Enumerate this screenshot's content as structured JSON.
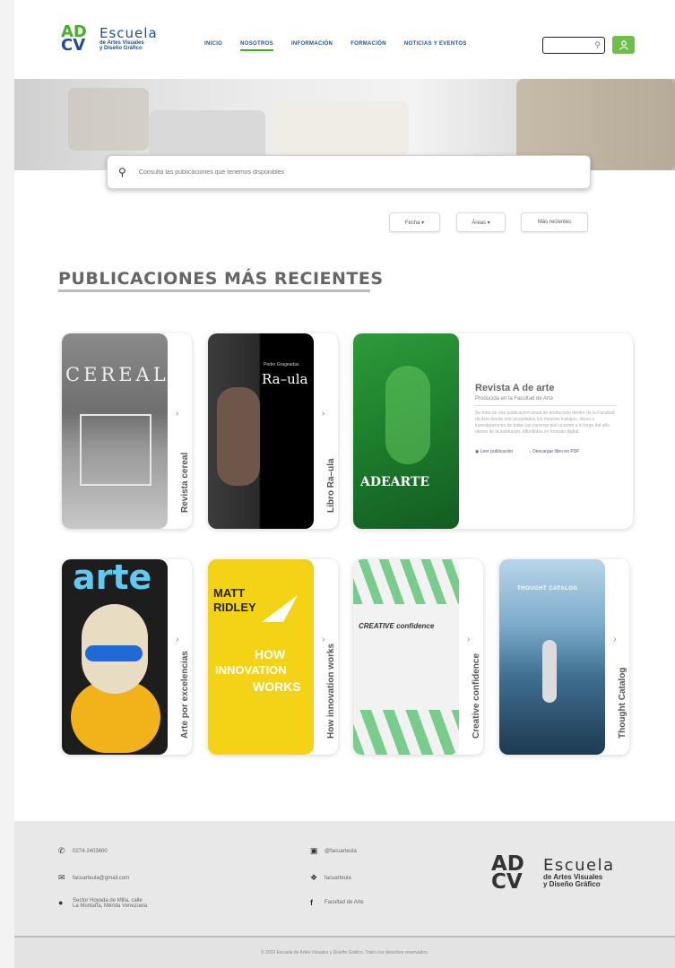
{
  "header": {
    "logo_mark_top": "AD",
    "logo_mark_bottom": "CV",
    "logo_title": "Escuela",
    "logo_subtitle_1": "de Artes Visuales",
    "logo_subtitle_2": "y Diseño Gráfico",
    "nav": [
      "INICIO",
      "NOSOTROS",
      "INFORMACIÓN",
      "FORMACIÓN",
      "NOTICIAS Y EVENTOS"
    ],
    "active_nav": "NOSOTROS",
    "search_icon": "search-icon",
    "user_icon": "user-icon"
  },
  "hero": {
    "search_placeholder": "Consulta las publicaciones que tenemos disponibles"
  },
  "filters": {
    "fecha": "Fecha ▾",
    "areas": "Áreas ▾",
    "recientes": "Más recientes"
  },
  "section": {
    "title": "PUBLICACIONES MÁS RECIENTES"
  },
  "publications": [
    {
      "label": "Revista cereal",
      "cover_text": "CEREAL"
    },
    {
      "label": "Libro Ra–ula",
      "cover_text": "Ra–ula",
      "cover_small": "Pedro Grageadas"
    },
    {
      "label": "Revista A de arte",
      "cover_text": "ADEARTE"
    },
    {
      "label": "Arte por excelencias",
      "cover_text": "arte"
    },
    {
      "label": "How innovation works",
      "cover_text_1": "MATT",
      "cover_text_2": "RIDLEY",
      "cover_text_3": "HOW",
      "cover_text_4": "INNOVATION",
      "cover_text_5": "WORKS"
    },
    {
      "label": "Creative confidence",
      "cover_text": "CREATIVE confidence"
    },
    {
      "label": "Thought Catalog",
      "cover_text": "THOUGHT CATALOG"
    }
  ],
  "featured": {
    "title": "Revista A de arte",
    "subtitle": "Producida en la Facultad de Arte",
    "description": "Se trata de una publicación anual de producción dentro de la Facultad de Arte donde son recopilados los mejores trabajos, obras e investigaciones de todas las carreras que ocurren a lo largo del año dentro de la institución, difundidos en formato digital.",
    "link_1": "Leer publicación",
    "link_2": "Descargar libro en PDF"
  },
  "footer": {
    "phone": "0274-2403600",
    "email": "facuarteula@gmail.com",
    "address_1": "Sector Hoyada de Milla, calle",
    "address_2": "La Montaña, Mérida Venezuela",
    "instagram": "@facuarteula",
    "twitter": "facuarteula",
    "facebook": "Facultad de Arte",
    "logo_title": "Escuela",
    "logo_subtitle_1": "de Artes Visuales",
    "logo_subtitle_2": "y Diseño Gráfico",
    "copyright": "© 2022 Escuela de Artes Visuales y Diseño Gráfico. Todos los derechos reservados."
  },
  "colors": {
    "brand_green": "#43b02a",
    "brand_blue": "#1d4f91"
  }
}
